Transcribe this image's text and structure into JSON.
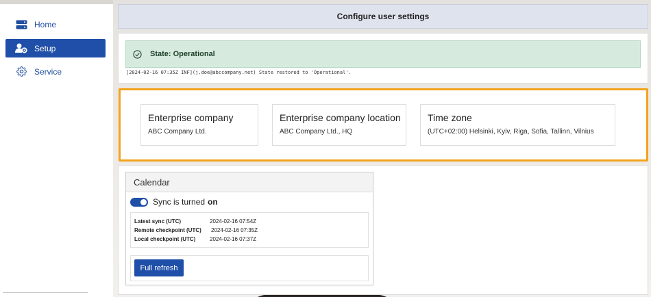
{
  "sidebar": {
    "items": [
      {
        "label": "Home",
        "icon": "server-icon",
        "active": false
      },
      {
        "label": "Setup",
        "icon": "user-settings-icon",
        "active": true
      },
      {
        "label": "Service",
        "icon": "gear-icon",
        "active": false
      }
    ]
  },
  "header": {
    "title": "Configure user settings"
  },
  "status": {
    "state_text": "State: Operational",
    "log": "[2024-02-16 07:35Z INF](j.doe@abccompany.net) State restored to 'Operational'."
  },
  "info": {
    "cards": [
      {
        "title": "Enterprise company",
        "value": "ABC Company Ltd."
      },
      {
        "title": "Enterprise company location",
        "value": "ABC Company Ltd., HQ"
      },
      {
        "title": "Time zone",
        "value": "(UTC+02:00) Helsinki, Kyiv, Riga, Sofia, Tallinn, Vilnius"
      }
    ]
  },
  "calendar": {
    "title": "Calendar",
    "sync_prefix": "Sync is turned",
    "sync_state": "on",
    "rows": [
      {
        "label": "Latest sync (UTC)",
        "value": "2024-02-16 07:54Z"
      },
      {
        "label": "Remote checkpoint (UTC)",
        "value": "2024-02-16 07:35Z"
      },
      {
        "label": "Local checkpoint (UTC)",
        "value": "2024-02-16 07:37Z"
      }
    ],
    "refresh_label": "Full refresh"
  },
  "colors": {
    "accent": "#1f4fa8",
    "highlight": "#f3a21b",
    "success_bg": "#d6ebde"
  }
}
